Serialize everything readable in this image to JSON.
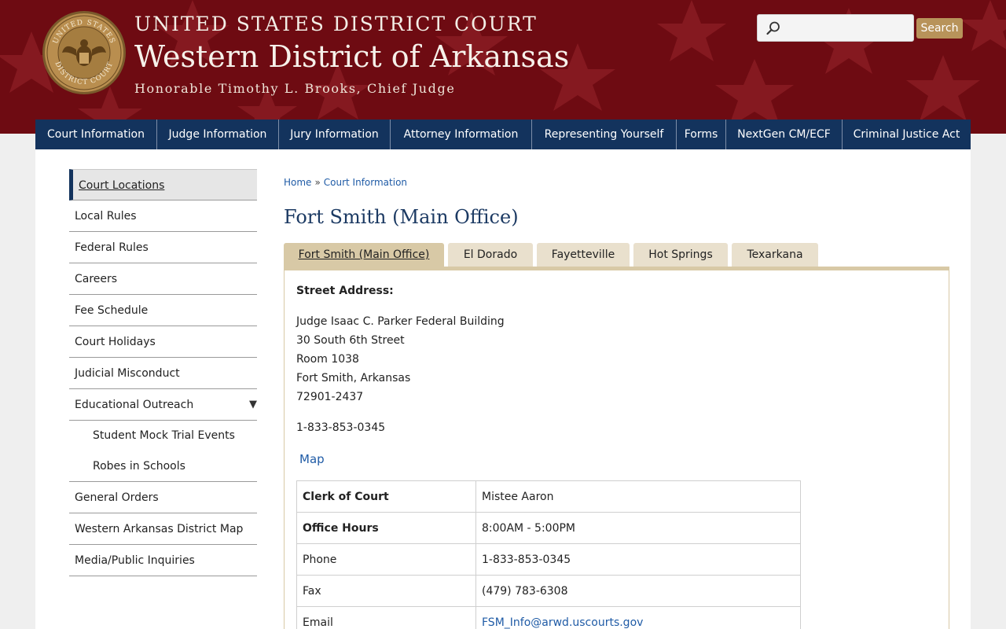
{
  "header": {
    "court_line": "UNITED STATES DISTRICT COURT",
    "district": "Western District of Arkansas",
    "judge": "Honorable Timothy L. Brooks, Chief Judge",
    "seal_top": "UNITED STATES",
    "seal_bottom": "DISTRICT COURT"
  },
  "search": {
    "placeholder": "",
    "button_label": "Search"
  },
  "nav": [
    "Court Information",
    "Judge Information",
    "Jury Information",
    "Attorney Information",
    "Representing Yourself",
    "Forms",
    "NextGen CM/ECF",
    "Criminal Justice Act"
  ],
  "sidebar": [
    "Court Locations",
    "Local Rules",
    "Federal Rules",
    "Careers",
    "Fee Schedule",
    "Court Holidays",
    "Judicial Misconduct",
    "Educational Outreach",
    "Student Mock Trial Events",
    "Robes in Schools",
    "General Orders",
    "Western Arkansas District Map",
    "Media/Public Inquiries"
  ],
  "sidebar_caret": "▼",
  "breadcrumb": {
    "home": "Home",
    "sep": "»",
    "current": "Court Information"
  },
  "page_title": "Fort Smith (Main Office)",
  "tabs": [
    "Fort Smith (Main Office)",
    "El Dorado",
    "Fayetteville",
    "Hot Springs",
    "Texarkana"
  ],
  "address": {
    "label": "Street Address:",
    "lines": [
      "Judge Isaac C. Parker Federal Building",
      "30 South 6th Street",
      "Room 1038",
      "Fort Smith, Arkansas",
      "72901-2437"
    ],
    "phone": "1-833-853-0345",
    "map_link": "Map"
  },
  "info_table": [
    {
      "key": "Clerk of Court",
      "value": "Mistee Aaron"
    },
    {
      "key": "Office Hours",
      "value": "8:00AM - 5:00PM"
    },
    {
      "key": "Phone",
      "value": "1-833-853-0345"
    },
    {
      "key": "Fax",
      "value": "(479) 783-6308"
    },
    {
      "key": "Email",
      "value": "FSM_Info@arwd.uscourts.gov"
    }
  ],
  "colors": {
    "header_bg": "#6e0b12",
    "nav_bg": "#13335d",
    "link": "#1f5ba6",
    "tab_bg": "#e9e0cd",
    "tab_active": "#d8c9a6",
    "search_button": "#b8935a"
  }
}
